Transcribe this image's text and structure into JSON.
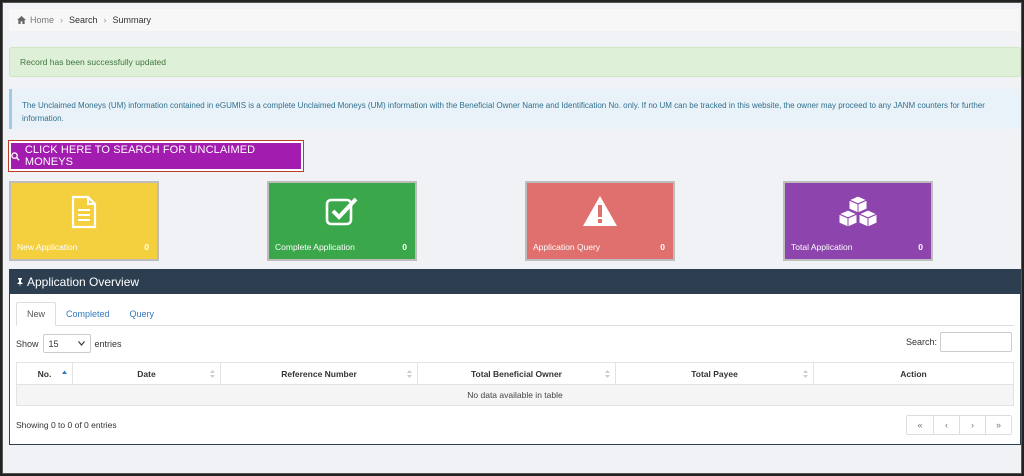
{
  "breadcrumb": {
    "home": "Home",
    "search": "Search",
    "summary": "Summary"
  },
  "alerts": {
    "success": "Record has been successfully updated",
    "info": "The Unclaimed Moneys (UM) information contained in eGUMIS is a complete Unclaimed Moneys (UM) information with the Beneficial Owner Name and Identification No. only. If no UM can be tracked in this website, the owner may proceed to any JANM counters for further information."
  },
  "search_button": {
    "label": "CLICK HERE TO SEARCH FOR UNCLAIMED MONEYS"
  },
  "tiles": [
    {
      "label": "New Application",
      "count": "0",
      "icon": "document-icon",
      "color": "#f4d03f"
    },
    {
      "label": "Complete Application",
      "count": "0",
      "icon": "check-square-icon",
      "color": "#3aa74a"
    },
    {
      "label": "Application Query",
      "count": "0",
      "icon": "warning-icon",
      "color": "#e0706d"
    },
    {
      "label": "Total Application",
      "count": "0",
      "icon": "cubes-icon",
      "color": "#8e44ad"
    }
  ],
  "overview": {
    "title": "Application Overview",
    "tabs": [
      "New",
      "Completed",
      "Query"
    ],
    "show_label": "Show",
    "entries_value": "15",
    "entries_label": "entries",
    "search_label": "Search:",
    "columns": [
      "No.",
      "Date",
      "Reference Number",
      "Total Beneficial Owner",
      "Total Payee",
      "Action"
    ],
    "empty_message": "No data available in table",
    "info": "Showing 0 to 0 of 0 entries",
    "pager": [
      "«",
      "‹",
      "›",
      "»"
    ]
  }
}
